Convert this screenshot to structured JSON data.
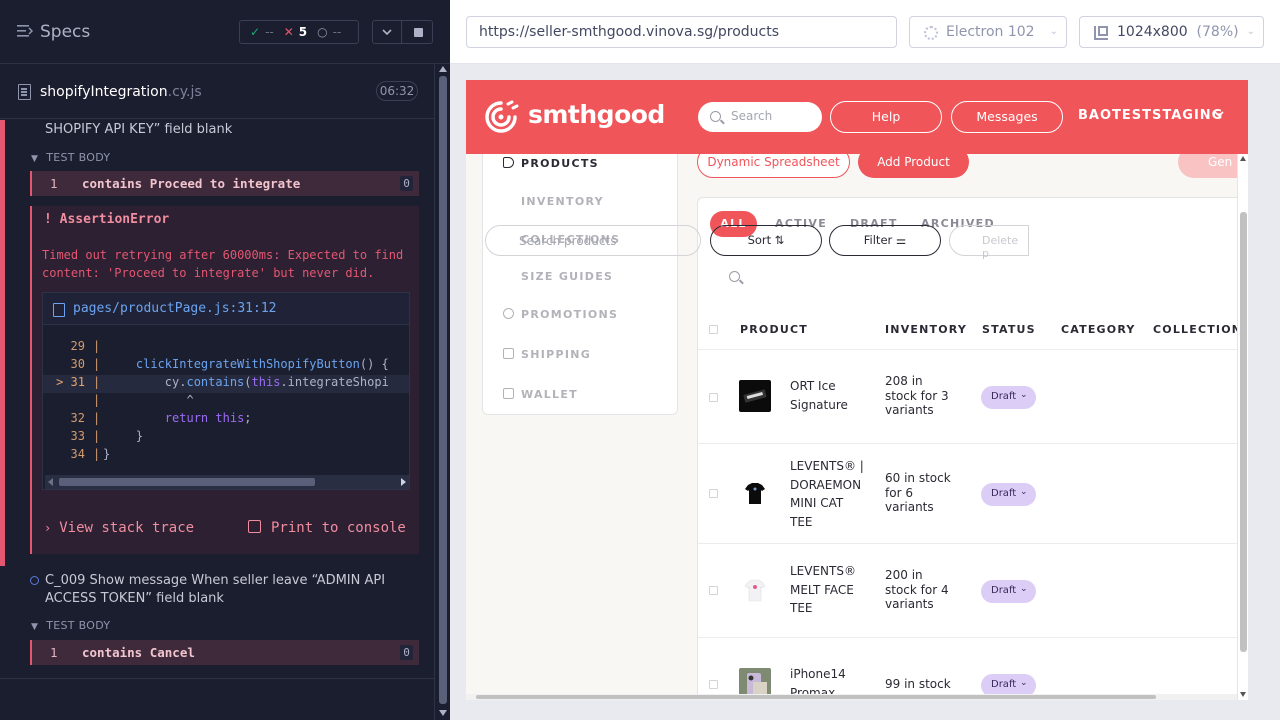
{
  "runner": {
    "title": "Specs",
    "stats": {
      "passed": "--",
      "failed": "5",
      "pending": "--"
    },
    "spec_file": {
      "name": "shopifyIntegration",
      "ext": ".cy.js"
    },
    "duration": "06:32",
    "previous_test_tail": "SHOPIFY API KEY” field blank",
    "test_body_label": "TEST BODY",
    "command_1": {
      "index": "1",
      "text": "contains  Proceed to integrate",
      "badge": "0"
    },
    "error": {
      "title": "! AssertionError",
      "message": "Timed out retrying after 60000ms: Expected to find content: 'Proceed to integrate' but never did.",
      "file": "pages/productPage.js:31:12",
      "lines": [
        {
          "num": "29",
          "pre": "",
          "code": ""
        },
        {
          "num": "30",
          "pre": "    ",
          "fn": "clickIntegrateWithShopifyButton",
          "code": "() {"
        },
        {
          "num": "> 31",
          "pre": "        cy.",
          "fn": "contains",
          "code": "(",
          "kw": "this",
          "tail": ".integrateShopi"
        },
        {
          "num": "",
          "pre": "",
          "caret": "           ^"
        },
        {
          "num": "32",
          "pre": "        ",
          "kw": "return",
          "tail": " ",
          "kw2": "this",
          "tail2": ";"
        },
        {
          "num": "33",
          "pre": "    }"
        },
        {
          "num": "34",
          "pre": "}"
        }
      ],
      "view_stack_trace": "View stack trace",
      "print_to_console": "Print to console"
    },
    "next_test": "C_009 Show message When seller leave “ADMIN API ACCESS TOKEN” field blank",
    "command_2": {
      "index": "1",
      "text": "contains  Cancel",
      "badge": "0"
    }
  },
  "browser": {
    "url": "https://seller-smthgood.vinova.sg/products",
    "browser_name": "Electron 102",
    "viewport": "1024x800",
    "viewport_scale": "(78%)"
  },
  "app": {
    "brand": "smthgood",
    "search_placeholder": "Search",
    "help": "Help",
    "messages": "Messages",
    "store": "BAOTESTSTAGING",
    "sidebar": [
      {
        "label": "PRODUCTS",
        "active": true,
        "icon": "tag-icon"
      },
      {
        "label": "INVENTORY"
      },
      {
        "label": "COLLECTIONS"
      },
      {
        "label": "SIZE GUIDES"
      },
      {
        "label": "PROMOTIONS",
        "icon": "percent-icon"
      },
      {
        "label": "SHIPPING",
        "icon": "box-icon"
      },
      {
        "label": "WALLET",
        "icon": "wallet-icon"
      }
    ],
    "btn_dynamic": "Dynamic Spreadsheet",
    "btn_add": "Add Product",
    "btn_gen": "Gen",
    "tabs": [
      "ALL",
      "ACTIVE",
      "DRAFT",
      "ARCHIVED"
    ],
    "product_search_placeholder": "Search products",
    "sort": "Sort",
    "filter": "Filter",
    "delete": "Delete p",
    "columns": [
      "PRODUCT",
      "INVENTORY",
      "STATUS",
      "CATEGORY",
      "COLLECTION"
    ],
    "products": [
      {
        "name": "ORT Ice Signature",
        "inventory": "208 in stock for 3 variants",
        "status": "Draft"
      },
      {
        "name": "LEVENTS® | DORAEMON MINI CAT TEE",
        "inventory": "60 in stock for 6 variants",
        "status": "Draft"
      },
      {
        "name": "LEVENTS® MELT FACE TEE",
        "inventory": "200 in stock for 4 variants",
        "status": "Draft"
      },
      {
        "name": "iPhone14 Promax",
        "inventory": "99 in stock",
        "status": "Draft"
      }
    ]
  }
}
